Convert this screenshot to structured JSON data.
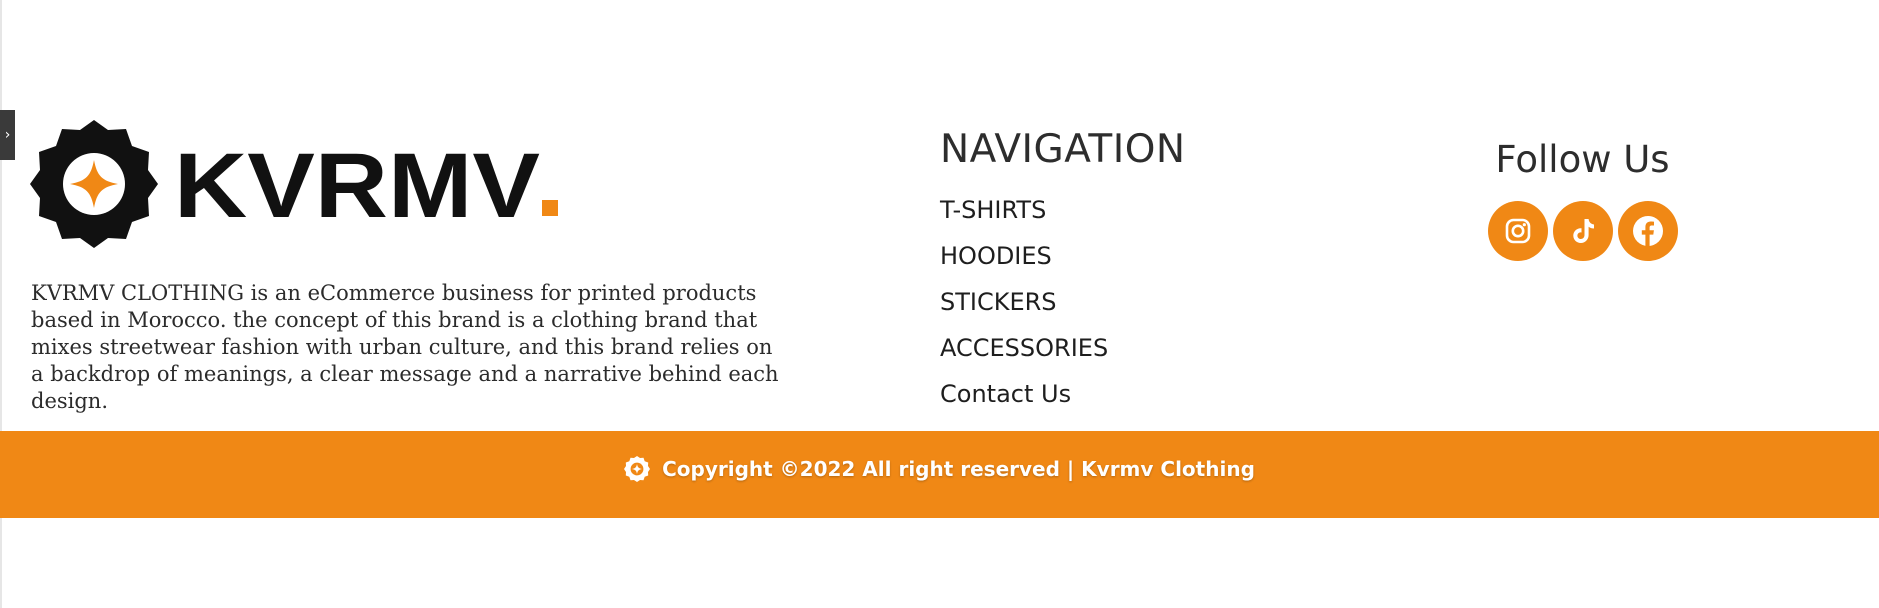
{
  "side_toggle": {
    "icon": "chevron-right-icon",
    "glyph": "›"
  },
  "brand": {
    "logo_text": "KVRMV",
    "logo_dot": ".",
    "description": "KVRMV CLOTHING is an eCommerce business for printed products based in Morocco. the concept of this brand is a clothing brand that mixes streetwear fashion with urban culture, and this brand relies on a backdrop of meanings, a clear message and a narrative behind each design."
  },
  "navigation": {
    "title": "NAVIGATION",
    "items": [
      {
        "label": "T-SHIRTS"
      },
      {
        "label": "HOODIES"
      },
      {
        "label": "STICKERS"
      },
      {
        "label": "ACCESSORIES"
      },
      {
        "label": "Contact Us"
      }
    ]
  },
  "follow": {
    "title": "Follow Us",
    "socials": [
      {
        "name": "instagram",
        "icon": "instagram-icon"
      },
      {
        "name": "tiktok",
        "icon": "tiktok-icon"
      },
      {
        "name": "facebook",
        "icon": "facebook-icon"
      }
    ]
  },
  "copyright": {
    "text": "Copyright ©2022 All right reserved | Kvrmv Clothing",
    "icon": "gear-star-icon"
  },
  "colors": {
    "accent": "#f08815",
    "text_dark": "#1a1a1a",
    "logo_black": "#111111",
    "background": "#ffffff"
  }
}
